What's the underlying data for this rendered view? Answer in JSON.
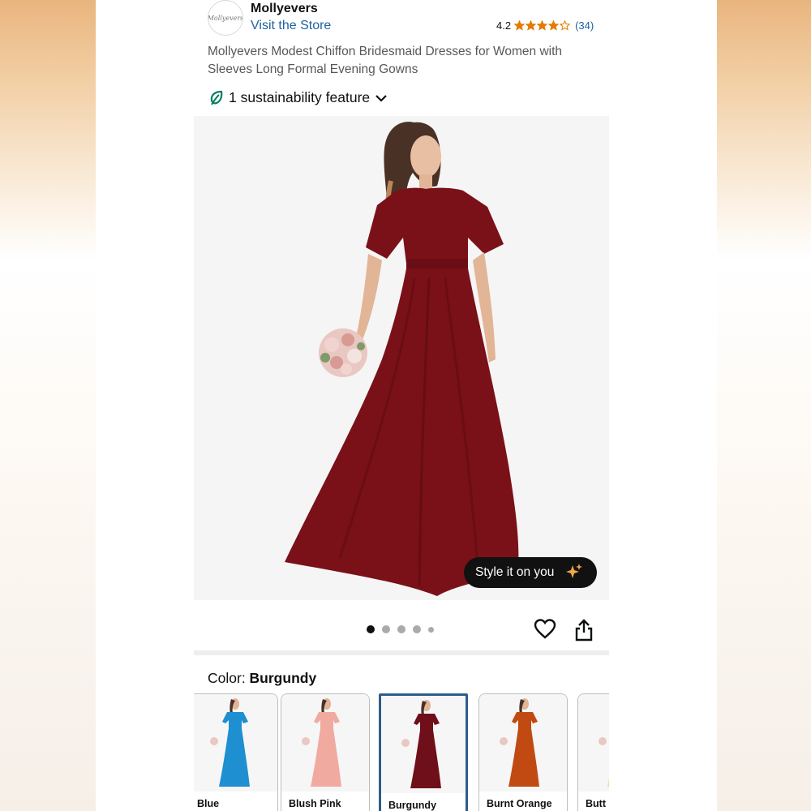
{
  "store": {
    "logo_text": "Mollyevers",
    "name": "Mollyevers",
    "visit_label": "Visit the Store"
  },
  "rating": {
    "value": "4.2",
    "count": "(34)",
    "stars": 4.2,
    "star_color": "#e67a00"
  },
  "product": {
    "title": "Mollyevers Modest Chiffon Bridesmaid Dresses for Women with Sleeves Long Formal Evening Gowns"
  },
  "sustainability": {
    "label": "1 sustainability feature",
    "icon": "leaf-icon",
    "icon_color": "#067d62"
  },
  "image": {
    "style_label": "Style it on you",
    "style_icon": "sparkle-icon",
    "dress_color": "#7a1118",
    "dot_count": 5,
    "active_dot": 1
  },
  "actions": {
    "favorite_icon": "heart-icon",
    "share_icon": "share-icon"
  },
  "color": {
    "label": "Color: ",
    "selected": "Burgundy",
    "options": [
      {
        "name": "Blue",
        "hex": "#1e8fd0"
      },
      {
        "name": "Blush Pink",
        "hex": "#f0aaa0"
      },
      {
        "name": "Burgundy",
        "hex": "#6e0f1a"
      },
      {
        "name": "Burnt Orange",
        "hex": "#c04a12"
      },
      {
        "name": "Butt",
        "hex": "#f2dc9b"
      }
    ]
  }
}
